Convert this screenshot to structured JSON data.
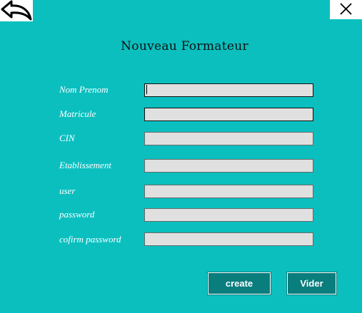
{
  "window": {
    "title": "Nouveau Formateur",
    "back_icon": "back-arrow-icon",
    "close_icon": "close-icon"
  },
  "form": {
    "fields": [
      {
        "label": "Nom Prenom",
        "value": "",
        "focused": true
      },
      {
        "label": "Matricule",
        "value": ""
      },
      {
        "label": "CIN",
        "value": ""
      },
      {
        "label": "Etablissement",
        "value": ""
      },
      {
        "label": "user",
        "value": ""
      },
      {
        "label": "password",
        "value": ""
      },
      {
        "label": "cofirm password",
        "value": ""
      }
    ]
  },
  "buttons": {
    "create_label": "create",
    "clear_label": "Vider"
  },
  "colors": {
    "background": "#0bbfbf",
    "button_bg": "#0a7d7d",
    "input_bg": "#e0e0e0",
    "label_text": "#ffffff"
  }
}
